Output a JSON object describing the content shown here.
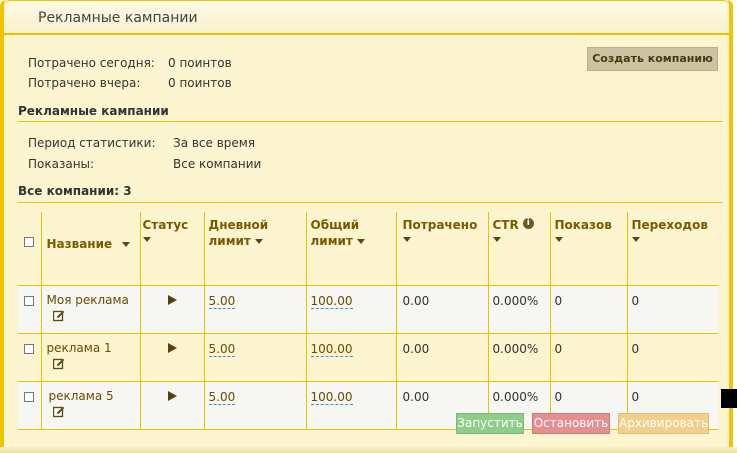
{
  "panel": {
    "title": "Рекламные кампании"
  },
  "summary": {
    "today_label": "Потрачено сегодня:",
    "today_value": "0 поинтов",
    "yesterday_label": "Потрачено вчера:",
    "yesterday_value": "0 поинтов"
  },
  "create_button": "Создать компанию",
  "campaigns_section": {
    "title": "Рекламные кампании",
    "period_label": "Период статистики:",
    "period_value": "За все время",
    "shown_label": "Показаны:",
    "shown_value": "Все компании"
  },
  "all_count": "Все компании: 3",
  "table": {
    "headers": {
      "name": "Название",
      "status": "Статус",
      "daily_1": "Дневной",
      "daily_2": "лимит",
      "total_1": "Общий",
      "total_2": "лимит",
      "spent": "Потрачено",
      "ctr": "CTR",
      "views": "Показов",
      "clicks": "Переходов"
    },
    "rows": [
      {
        "name": "Моя реклама",
        "daily": "5.00",
        "total": "100.00",
        "spent": "0.00",
        "ctr": "0.000%",
        "views": "0",
        "clicks": "0"
      },
      {
        "name": "реклама 1",
        "daily": "5.00",
        "total": "100.00",
        "spent": "0.00",
        "ctr": "0.000%",
        "views": "0",
        "clicks": "0"
      },
      {
        "name": "реклама 5",
        "daily": "5.00",
        "total": "100.00",
        "spent": "0.00",
        "ctr": "0.000%",
        "views": "0",
        "clicks": "0"
      }
    ]
  },
  "actions": {
    "start": "Запустить",
    "stop": "Остановить",
    "archive": "Архивировать"
  },
  "colors": {
    "panel_bg": "#fdf5d0",
    "accent": "#f0c400",
    "start_btn": "#8fce8a",
    "stop_btn": "#e58f8f",
    "archive_btn": "#f2cf8a"
  }
}
